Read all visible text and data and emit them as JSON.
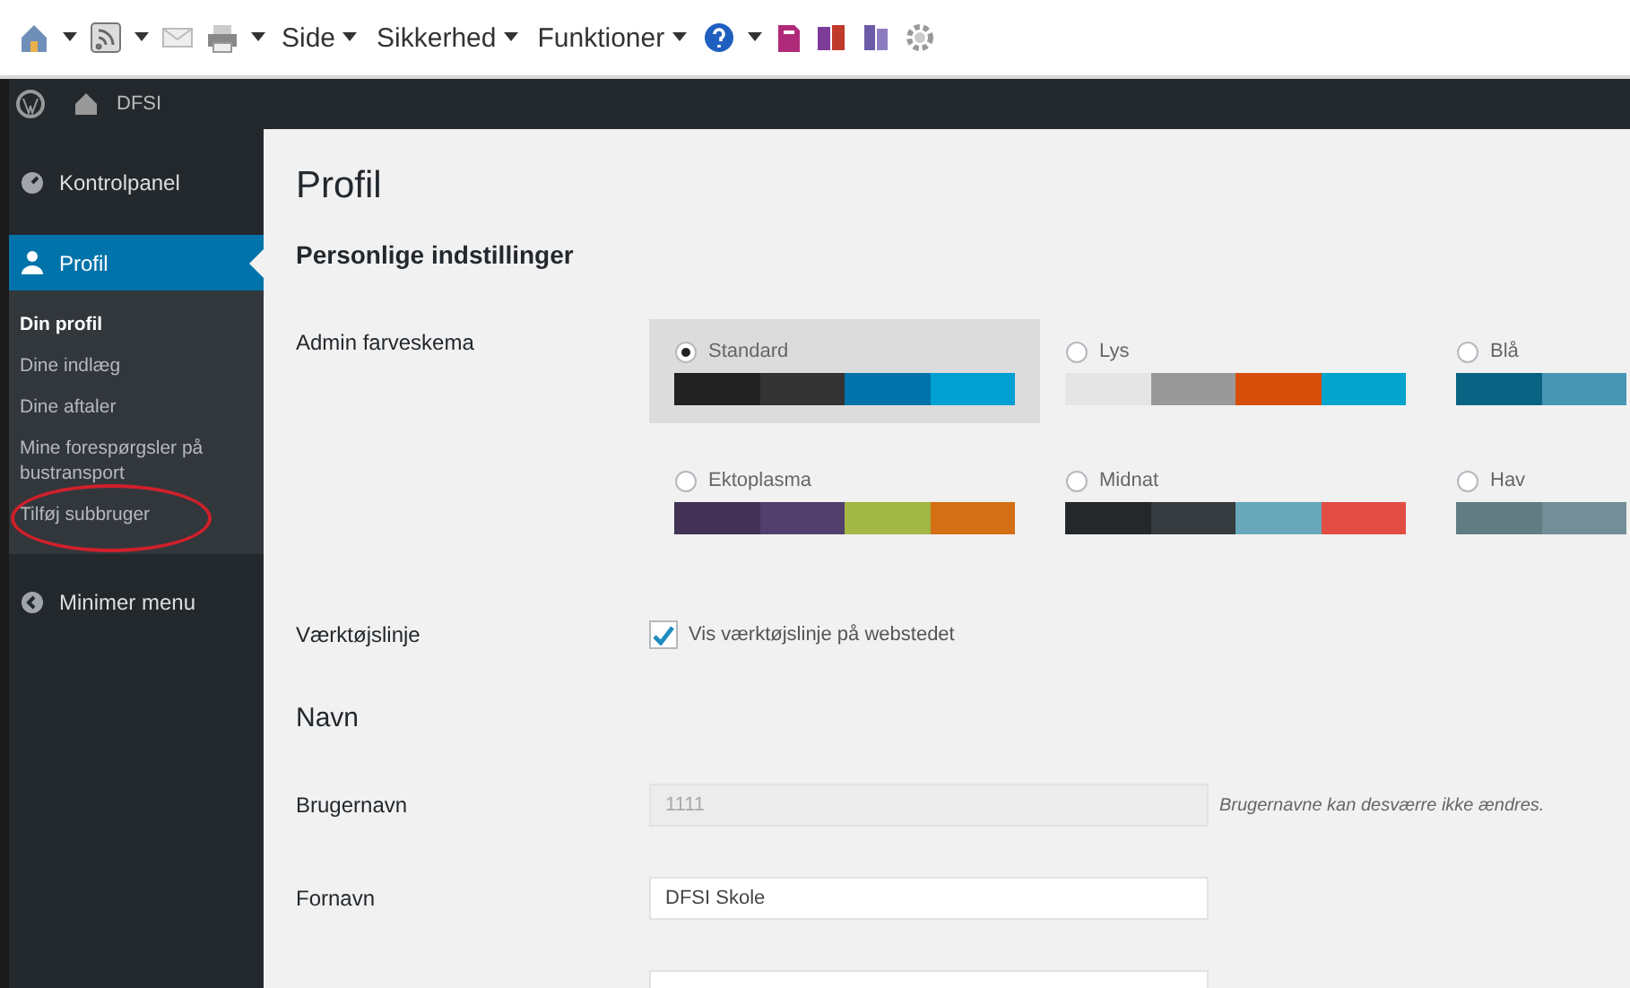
{
  "browser_toolbar": {
    "menus": [
      {
        "label": "Side"
      },
      {
        "label": "Sikkerhed"
      },
      {
        "label": "Funktioner"
      }
    ]
  },
  "admin_bar": {
    "site": "DFSI"
  },
  "sidebar": {
    "items": [
      {
        "label": "Kontrolpanel",
        "kind": "gauge",
        "selected": false
      },
      {
        "label": "Profil",
        "kind": "user",
        "selected": true,
        "children": [
          {
            "label": "Din profil",
            "selected": true,
            "highlight": false
          },
          {
            "label": "Dine indlæg",
            "selected": false,
            "highlight": false
          },
          {
            "label": "Dine aftaler",
            "selected": false,
            "highlight": false
          },
          {
            "label": "Mine forespørgsler på bustransport",
            "selected": false,
            "highlight": false
          },
          {
            "label": "Tilføj subbruger",
            "selected": false,
            "highlight": true
          }
        ]
      },
      {
        "label": "Minimer menu",
        "kind": "collapse",
        "selected": false
      }
    ]
  },
  "page": {
    "title": "Profil",
    "section": "Personlige indstillinger",
    "color_scheme": {
      "label": "Admin farveskema",
      "schemes": [
        {
          "name": "Standard",
          "selected": true,
          "colors": [
            {
              "color": "#222222"
            },
            {
              "color": "#333333"
            },
            {
              "color": "#0073aa"
            },
            {
              "color": "#00a0d2"
            }
          ]
        },
        {
          "name": "Lys",
          "selected": false,
          "colors": [
            {
              "color": "#e5e5e5"
            },
            {
              "color": "#999999"
            },
            {
              "color": "#d64e07"
            },
            {
              "color": "#04a4cc"
            }
          ]
        },
        {
          "name": "Blå",
          "selected": false,
          "colors": [
            {
              "color": "#096484"
            },
            {
              "color": "#4796b3"
            }
          ]
        },
        {
          "name": "Ektoplasma",
          "selected": false,
          "colors": [
            {
              "color": "#413256"
            },
            {
              "color": "#523f6d"
            },
            {
              "color": "#a3b745"
            },
            {
              "color": "#d46f15"
            }
          ]
        },
        {
          "name": "Midnat",
          "selected": false,
          "colors": [
            {
              "color": "#25282b"
            },
            {
              "color": "#363b3f"
            },
            {
              "color": "#69a8bb"
            },
            {
              "color": "#e14d43"
            }
          ]
        },
        {
          "name": "Hav",
          "selected": false,
          "colors": [
            {
              "color": "#627c83"
            },
            {
              "color": "#738e96"
            }
          ]
        }
      ]
    },
    "toolbar_option": {
      "label": "Værktøjslinje",
      "text": "Vis værktøjslinje på webstedet",
      "checked": true
    },
    "name_section": "Navn",
    "fields": [
      {
        "label": "Brugernavn",
        "value": "1111",
        "disabled": true,
        "hint": "Brugernavne kan desværre ikke ændres."
      },
      {
        "label": "Fornavn",
        "value": "DFSI Skole",
        "disabled": false
      },
      {
        "disabled": false
      }
    ]
  }
}
